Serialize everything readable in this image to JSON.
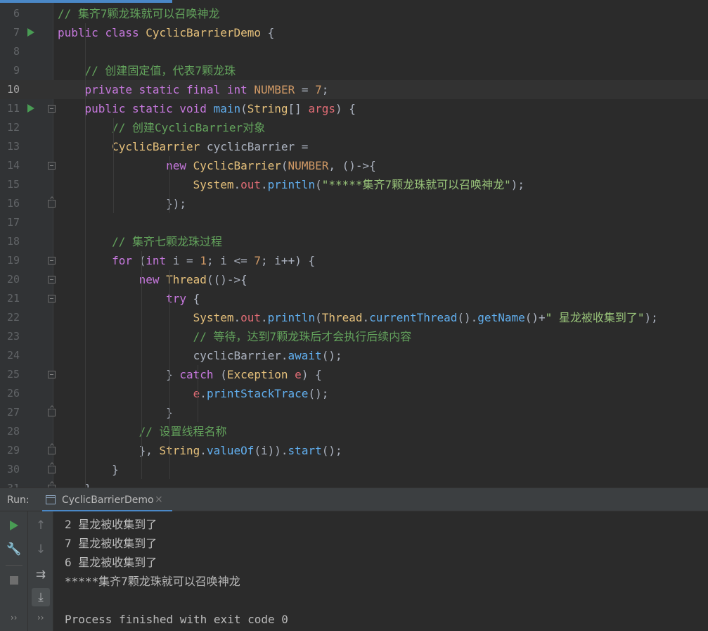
{
  "editor": {
    "lines": [
      {
        "n": "6",
        "segs": [
          [
            "c-comment",
            "// 集齐7颗龙珠就可以召唤神龙"
          ]
        ]
      },
      {
        "n": "7",
        "run": true,
        "segs": [
          [
            "c-keyword",
            "public"
          ],
          [
            "c-plain",
            " "
          ],
          [
            "c-keyword",
            "class"
          ],
          [
            "c-plain",
            " "
          ],
          [
            "c-type",
            "CyclicBarrierDemo"
          ],
          [
            "c-plain",
            " {"
          ]
        ]
      },
      {
        "n": "8",
        "segs": []
      },
      {
        "n": "9",
        "segs": [
          [
            "c-plain",
            "    "
          ],
          [
            "c-comment",
            "// 创建固定值，代表7颗龙珠"
          ]
        ]
      },
      {
        "n": "10",
        "current": true,
        "segs": [
          [
            "c-plain",
            "    "
          ],
          [
            "c-keyword",
            "private"
          ],
          [
            "c-plain",
            " "
          ],
          [
            "c-keyword",
            "static"
          ],
          [
            "c-plain",
            " "
          ],
          [
            "c-keyword",
            "final"
          ],
          [
            "c-plain",
            " "
          ],
          [
            "c-keyword",
            "int"
          ],
          [
            "c-plain",
            " "
          ],
          [
            "c-const",
            "NUMBER"
          ],
          [
            "c-plain",
            " = "
          ],
          [
            "c-number",
            "7"
          ],
          [
            "c-plain",
            ";"
          ]
        ]
      },
      {
        "n": "11",
        "run": true,
        "fold": "open",
        "segs": [
          [
            "c-plain",
            "    "
          ],
          [
            "c-keyword",
            "public"
          ],
          [
            "c-plain",
            " "
          ],
          [
            "c-keyword",
            "static"
          ],
          [
            "c-plain",
            " "
          ],
          [
            "c-keyword",
            "void"
          ],
          [
            "c-plain",
            " "
          ],
          [
            "c-method",
            "main"
          ],
          [
            "c-plain",
            "("
          ],
          [
            "c-type",
            "String"
          ],
          [
            "c-plain",
            "[] "
          ],
          [
            "c-param",
            "args"
          ],
          [
            "c-plain",
            ") {"
          ]
        ]
      },
      {
        "n": "12",
        "segs": [
          [
            "c-plain",
            "        "
          ],
          [
            "c-comment",
            "// 创建CyclicBarrier对象"
          ]
        ]
      },
      {
        "n": "13",
        "segs": [
          [
            "c-plain",
            "        "
          ],
          [
            "c-type",
            "CyclicBarrier"
          ],
          [
            "c-plain",
            " cyclicBarrier ="
          ]
        ]
      },
      {
        "n": "14",
        "fold": "open",
        "segs": [
          [
            "c-plain",
            "                "
          ],
          [
            "c-keyword",
            "new"
          ],
          [
            "c-plain",
            " "
          ],
          [
            "c-type",
            "CyclicBarrier"
          ],
          [
            "c-plain",
            "("
          ],
          [
            "c-const",
            "NUMBER"
          ],
          [
            "c-plain",
            ", ()->{"
          ]
        ]
      },
      {
        "n": "15",
        "segs": [
          [
            "c-plain",
            "                    "
          ],
          [
            "c-type",
            "System"
          ],
          [
            "c-plain",
            "."
          ],
          [
            "c-field",
            "out"
          ],
          [
            "c-plain",
            "."
          ],
          [
            "c-method",
            "println"
          ],
          [
            "c-plain",
            "("
          ],
          [
            "c-string",
            "\"*****集齐7颗龙珠就可以召唤神龙\""
          ],
          [
            "c-plain",
            ");"
          ]
        ]
      },
      {
        "n": "16",
        "fold": "end",
        "segs": [
          [
            "c-plain",
            "                });"
          ]
        ]
      },
      {
        "n": "17",
        "segs": []
      },
      {
        "n": "18",
        "segs": [
          [
            "c-plain",
            "        "
          ],
          [
            "c-comment",
            "// 集齐七颗龙珠过程"
          ]
        ]
      },
      {
        "n": "19",
        "fold": "open",
        "segs": [
          [
            "c-plain",
            "        "
          ],
          [
            "c-keyword",
            "for"
          ],
          [
            "c-plain",
            " ("
          ],
          [
            "c-keyword",
            "int"
          ],
          [
            "c-plain",
            " i = "
          ],
          [
            "c-number",
            "1"
          ],
          [
            "c-plain",
            "; i <= "
          ],
          [
            "c-number",
            "7"
          ],
          [
            "c-plain",
            "; i++) {"
          ]
        ]
      },
      {
        "n": "20",
        "fold": "open",
        "segs": [
          [
            "c-plain",
            "            "
          ],
          [
            "c-keyword",
            "new"
          ],
          [
            "c-plain",
            " "
          ],
          [
            "c-type",
            "Thread"
          ],
          [
            "c-plain",
            "(()->{"
          ]
        ]
      },
      {
        "n": "21",
        "fold": "open",
        "segs": [
          [
            "c-plain",
            "                "
          ],
          [
            "c-keyword",
            "try"
          ],
          [
            "c-plain",
            " {"
          ]
        ]
      },
      {
        "n": "22",
        "segs": [
          [
            "c-plain",
            "                    "
          ],
          [
            "c-type",
            "System"
          ],
          [
            "c-plain",
            "."
          ],
          [
            "c-field",
            "out"
          ],
          [
            "c-plain",
            "."
          ],
          [
            "c-method",
            "println"
          ],
          [
            "c-plain",
            "("
          ],
          [
            "c-type",
            "Thread"
          ],
          [
            "c-plain",
            "."
          ],
          [
            "c-method",
            "currentThread"
          ],
          [
            "c-plain",
            "()."
          ],
          [
            "c-method",
            "getName"
          ],
          [
            "c-plain",
            "()+"
          ],
          [
            "c-string",
            "\" 星龙被收集到了\""
          ],
          [
            "c-plain",
            ");"
          ]
        ]
      },
      {
        "n": "23",
        "segs": [
          [
            "c-plain",
            "                    "
          ],
          [
            "c-comment",
            "// 等待，达到7颗龙珠后才会执行后续内容"
          ]
        ]
      },
      {
        "n": "24",
        "segs": [
          [
            "c-plain",
            "                    cyclicBarrier."
          ],
          [
            "c-method",
            "await"
          ],
          [
            "c-plain",
            "();"
          ]
        ]
      },
      {
        "n": "25",
        "fold": "open",
        "segs": [
          [
            "c-plain",
            "                } "
          ],
          [
            "c-keyword",
            "catch"
          ],
          [
            "c-plain",
            " ("
          ],
          [
            "c-type",
            "Exception"
          ],
          [
            "c-plain",
            " "
          ],
          [
            "c-param",
            "e"
          ],
          [
            "c-plain",
            ") {"
          ]
        ]
      },
      {
        "n": "26",
        "segs": [
          [
            "c-plain",
            "                    "
          ],
          [
            "c-param",
            "e"
          ],
          [
            "c-plain",
            "."
          ],
          [
            "c-method",
            "printStackTrace"
          ],
          [
            "c-plain",
            "();"
          ]
        ]
      },
      {
        "n": "27",
        "fold": "end",
        "segs": [
          [
            "c-plain",
            "                }"
          ]
        ]
      },
      {
        "n": "28",
        "segs": [
          [
            "c-plain",
            "            "
          ],
          [
            "c-comment",
            "// 设置线程名称"
          ]
        ]
      },
      {
        "n": "29",
        "fold": "end",
        "segs": [
          [
            "c-plain",
            "            }, "
          ],
          [
            "c-type",
            "String"
          ],
          [
            "c-plain",
            "."
          ],
          [
            "c-method",
            "valueOf"
          ],
          [
            "c-plain",
            "(i))."
          ],
          [
            "c-method",
            "start"
          ],
          [
            "c-plain",
            "();"
          ]
        ]
      },
      {
        "n": "30",
        "fold": "end",
        "segs": [
          [
            "c-plain",
            "        }"
          ]
        ]
      },
      {
        "n": "31",
        "fold": "end",
        "segs": [
          [
            "c-plain",
            "    }"
          ]
        ]
      }
    ]
  },
  "run": {
    "label": "Run:",
    "tab_title": "CyclicBarrierDemo",
    "close_glyph": "×",
    "chevron": "››"
  },
  "console": {
    "lines": [
      "2 星龙被收集到了",
      "7 星龙被收集到了",
      "6 星龙被收集到了",
      "*****集齐7颗龙珠就可以召唤神龙",
      "",
      "Process finished with exit code 0"
    ]
  },
  "icons": {
    "rerun": "play-icon",
    "settings": "wrench-icon",
    "stop": "stop-icon",
    "up": "arrow-up-icon",
    "down": "arrow-down-icon",
    "soft_wrap": "soft-wrap-icon",
    "scroll_to_end": "scroll-to-end-icon"
  },
  "colors": {
    "accent": "#4a88c7",
    "run_green": "#499c54"
  }
}
